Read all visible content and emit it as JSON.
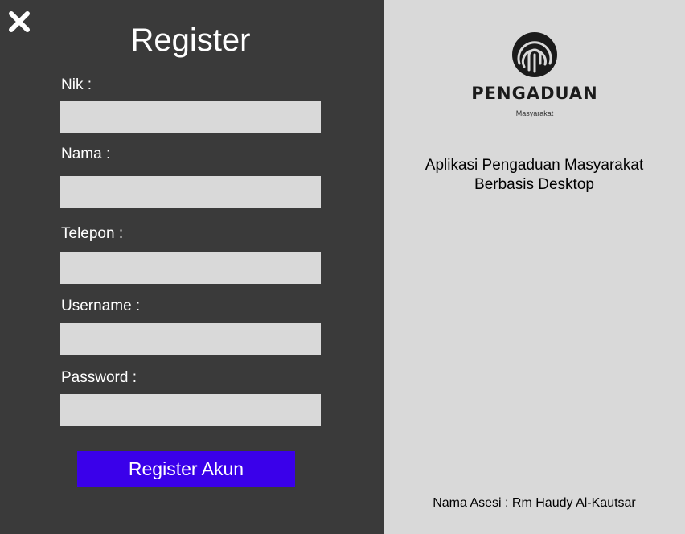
{
  "window": {
    "close_icon": "close-icon"
  },
  "form": {
    "title": "Register",
    "fields": [
      {
        "label": "Nik :",
        "value": ""
      },
      {
        "label": "Nama :",
        "value": ""
      },
      {
        "label": "Telepon :",
        "value": ""
      },
      {
        "label": "Username :",
        "value": ""
      },
      {
        "label": "Password :",
        "value": ""
      }
    ],
    "submit_label": "Register Akun",
    "colors": {
      "panel_bg": "#3a3a3a",
      "field_bg": "#d9d9d9",
      "button_bg": "#3a00ea"
    }
  },
  "info": {
    "logo_icon": "fingerprint-logo-icon",
    "brand": "PENGADUAN",
    "brand_sub": "Masyarakat",
    "description_line1": "Aplikasi Pengaduan Masyarakat",
    "description_line2": "Berbasis Desktop",
    "footer": "Nama Asesi : Rm Haudy Al-Kautsar",
    "colors": {
      "panel_bg": "#d9d9d9"
    }
  }
}
